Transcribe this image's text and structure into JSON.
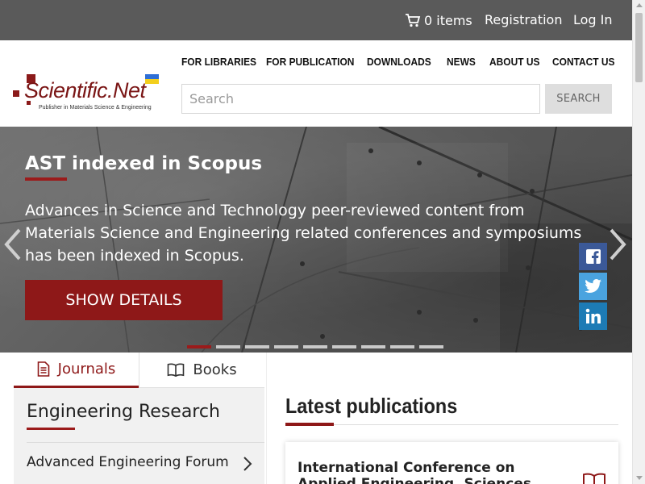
{
  "topbar": {
    "cart_label": "0 items",
    "registration_label": "Registration",
    "login_label": "Log In"
  },
  "logo": {
    "name": "Scientific.Net",
    "tagline": "Publisher in Materials Science & Engineering"
  },
  "nav": {
    "items": [
      {
        "label": "FOR LIBRARIES"
      },
      {
        "label": "FOR PUBLICATION"
      },
      {
        "label": "DOWNLOADS"
      },
      {
        "label": "NEWS"
      },
      {
        "label": "ABOUT US"
      },
      {
        "label": "CONTACT US"
      }
    ]
  },
  "search": {
    "placeholder": "Search",
    "value": "",
    "button_label": "SEARCH"
  },
  "hero": {
    "title": "AST indexed in Scopus",
    "text": "Advances in Science and Technology peer-reviewed content from Materials Science and Engineering related conferences and symposiums has been indexed in Scopus.",
    "button_label": "SHOW DETAILS",
    "slide_count": 9,
    "active_slide": 1
  },
  "social": {
    "icons": [
      "facebook-icon",
      "twitter-icon",
      "linkedin-icon"
    ]
  },
  "tabs": [
    {
      "label": "Journals",
      "active": true,
      "icon": "document-icon"
    },
    {
      "label": "Books",
      "active": false,
      "icon": "book-icon"
    }
  ],
  "panel": {
    "title": "Engineering Research",
    "items": [
      {
        "label": "Advanced Engineering Forum"
      }
    ]
  },
  "latest": {
    "title": "Latest publications",
    "card_title": "International Conference on Applied Engineering, Sciences"
  },
  "colors": {
    "accent": "#8e1818",
    "topbar": "#5a5a5a",
    "facebook": "#3b5998",
    "twitter": "#4aa3df",
    "linkedin": "#1d7bb5"
  }
}
